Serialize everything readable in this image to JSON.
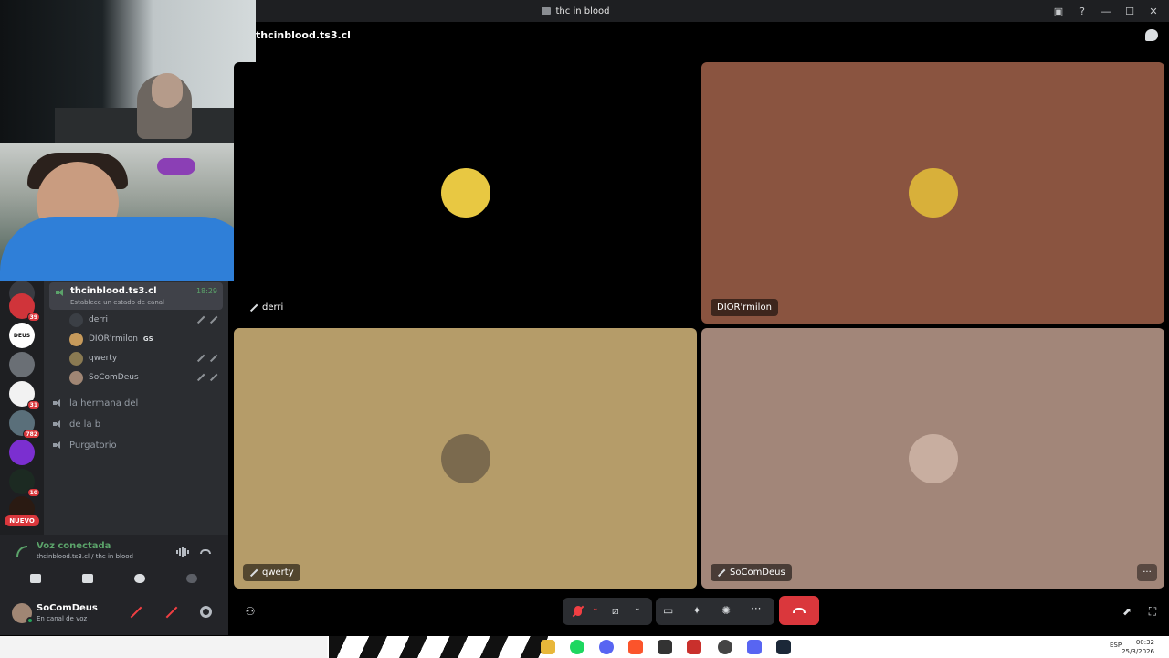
{
  "window": {
    "title": "thc in blood"
  },
  "call_header": {
    "server_name": "thcinblood.ts3.cl"
  },
  "rail": {
    "servers": [
      {
        "label": "",
        "badge": "39",
        "color": "#d0343a"
      },
      {
        "label": "DEUS",
        "badge": "",
        "color": "#ffffff"
      },
      {
        "label": "",
        "badge": "",
        "color": "#6a6f75"
      },
      {
        "label": "",
        "badge": "31",
        "color": "#f2f2f2"
      },
      {
        "label": "",
        "badge": "782",
        "color": "#5a6f7a"
      },
      {
        "label": "",
        "badge": "",
        "color": "#7b2fd0"
      },
      {
        "label": "",
        "badge": "10",
        "color": "#1c2a22"
      },
      {
        "label": "",
        "badge": "",
        "color": "#2a1a12"
      }
    ],
    "nuevo": "NUEVO"
  },
  "sidebar": {
    "active_channel": {
      "name": "thcinblood.ts3.cl",
      "status": "Establece un estado de canal",
      "time": "18:29"
    },
    "members": [
      {
        "name": "derri",
        "extra": "",
        "avatar_color": "#3b3f45"
      },
      {
        "name": "DIOR'rmilon",
        "extra": "GS",
        "avatar_color": "#c69a5b"
      },
      {
        "name": "qwerty",
        "extra": "",
        "avatar_color": "#8a7a52"
      },
      {
        "name": "SoComDeus",
        "extra": "",
        "avatar_color": "#a08674"
      }
    ],
    "voice_channels": [
      "la hermana del",
      "de la b",
      "Purgatorio"
    ]
  },
  "voice_panel": {
    "title": "Voz conectada",
    "subtitle": "thcinblood.ts3.cl / thc in blood"
  },
  "user": {
    "name": "SoComDeus",
    "status": "En canal de voz"
  },
  "tiles": [
    {
      "name": "derri",
      "bg": "#000000",
      "avatar_color": "#e8c842"
    },
    {
      "name": "DIOR'rmilon",
      "bg": "#8a5440",
      "avatar_color": "#d8b03a"
    },
    {
      "name": "qwerty",
      "bg": "#b59c69",
      "avatar_color": "#7b6a4e"
    },
    {
      "name": "SoComDeus",
      "bg": "#a28679",
      "avatar_color": "#c8aea0"
    }
  ],
  "taskbar": {
    "language": "ESP",
    "time": "00:32",
    "date": "25/3/2026"
  },
  "colors": {
    "accent_green": "#5ba36a",
    "hangup_red": "#da373c",
    "sidebar_bg": "#2b2d31",
    "rail_bg": "#1e1f22"
  }
}
